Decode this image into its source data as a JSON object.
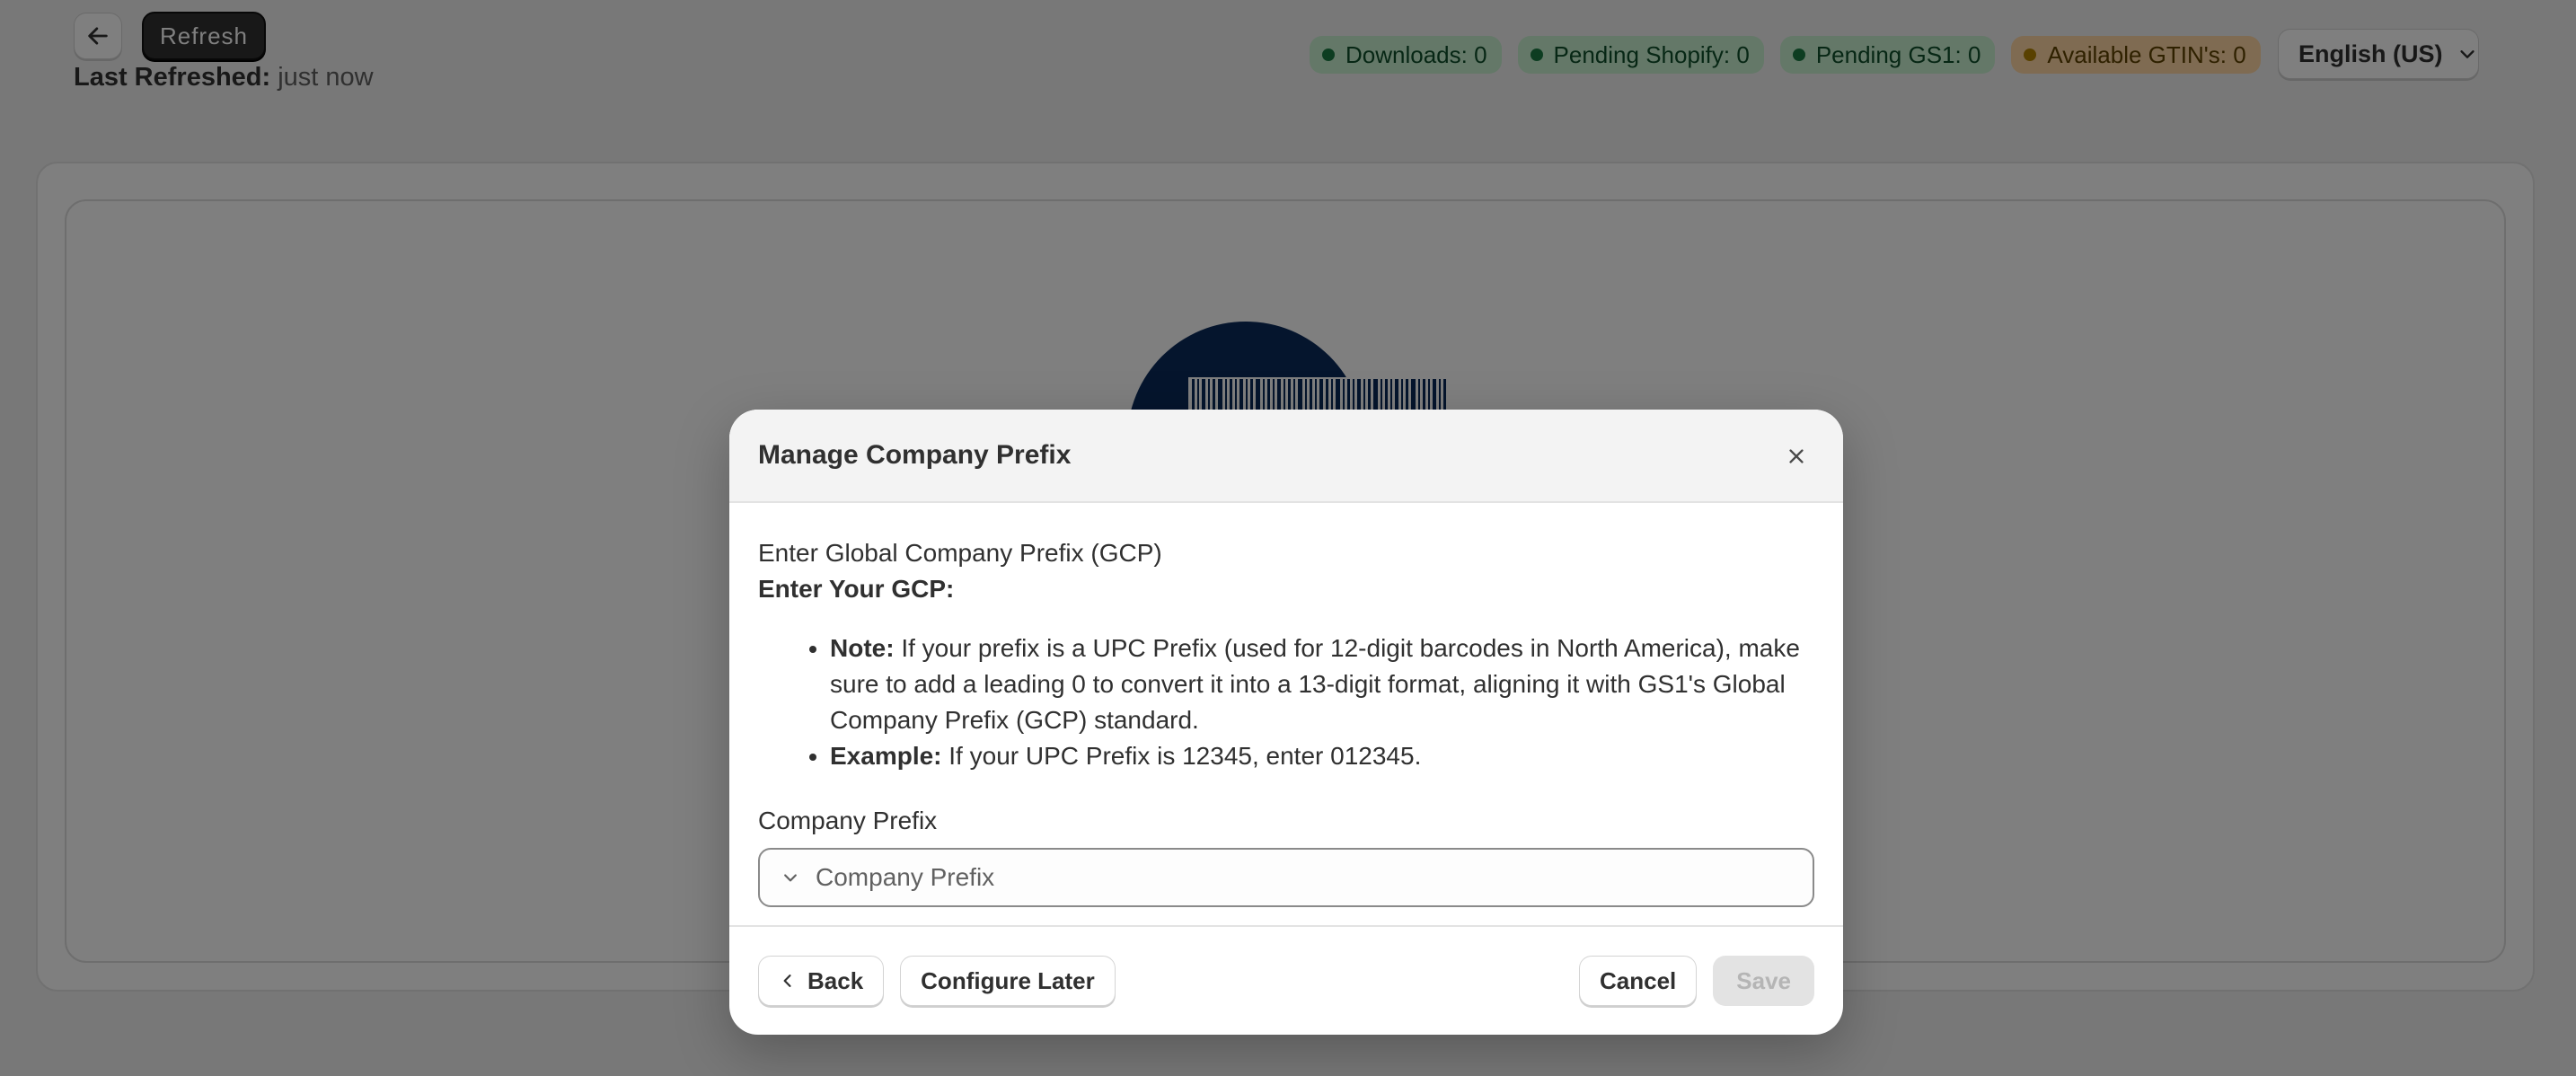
{
  "toolbar": {
    "refresh_label": "Refresh",
    "last_refreshed_label": "Last Refreshed:",
    "last_refreshed_value": "just now"
  },
  "status_badges": [
    {
      "label": "Downloads: 0",
      "tone": "success"
    },
    {
      "label": "Pending Shopify: 0",
      "tone": "success"
    },
    {
      "label": "Pending GS1: 0",
      "tone": "success"
    },
    {
      "label": "Available GTIN's: 0",
      "tone": "warning"
    }
  ],
  "language": {
    "selected": "English (US)"
  },
  "modal": {
    "title": "Manage Company Prefix",
    "intro": "Enter Global Company Prefix (GCP)",
    "gcp_heading": "Enter Your GCP:",
    "notes": [
      {
        "label": "Note:",
        "text": " If your prefix is a UPC Prefix (used for 12-digit barcodes in North America), make sure to add a leading 0 to convert it into a 13-digit format, aligning it with GS1's Global Company Prefix (GCP) standard."
      },
      {
        "label": "Example:",
        "text": " If your UPC Prefix is 12345, enter 012345."
      }
    ],
    "field_label": "Company Prefix",
    "field_placeholder": "Company Prefix",
    "buttons": {
      "back": "Back",
      "configure_later": "Configure Later",
      "cancel": "Cancel",
      "save": "Save"
    }
  },
  "colors": {
    "primary_dark": "#303030",
    "badge_success_bg": "#c8f0d0",
    "badge_warning_bg": "#ffd6a4",
    "illustration_navy": "#0b2a5b"
  }
}
